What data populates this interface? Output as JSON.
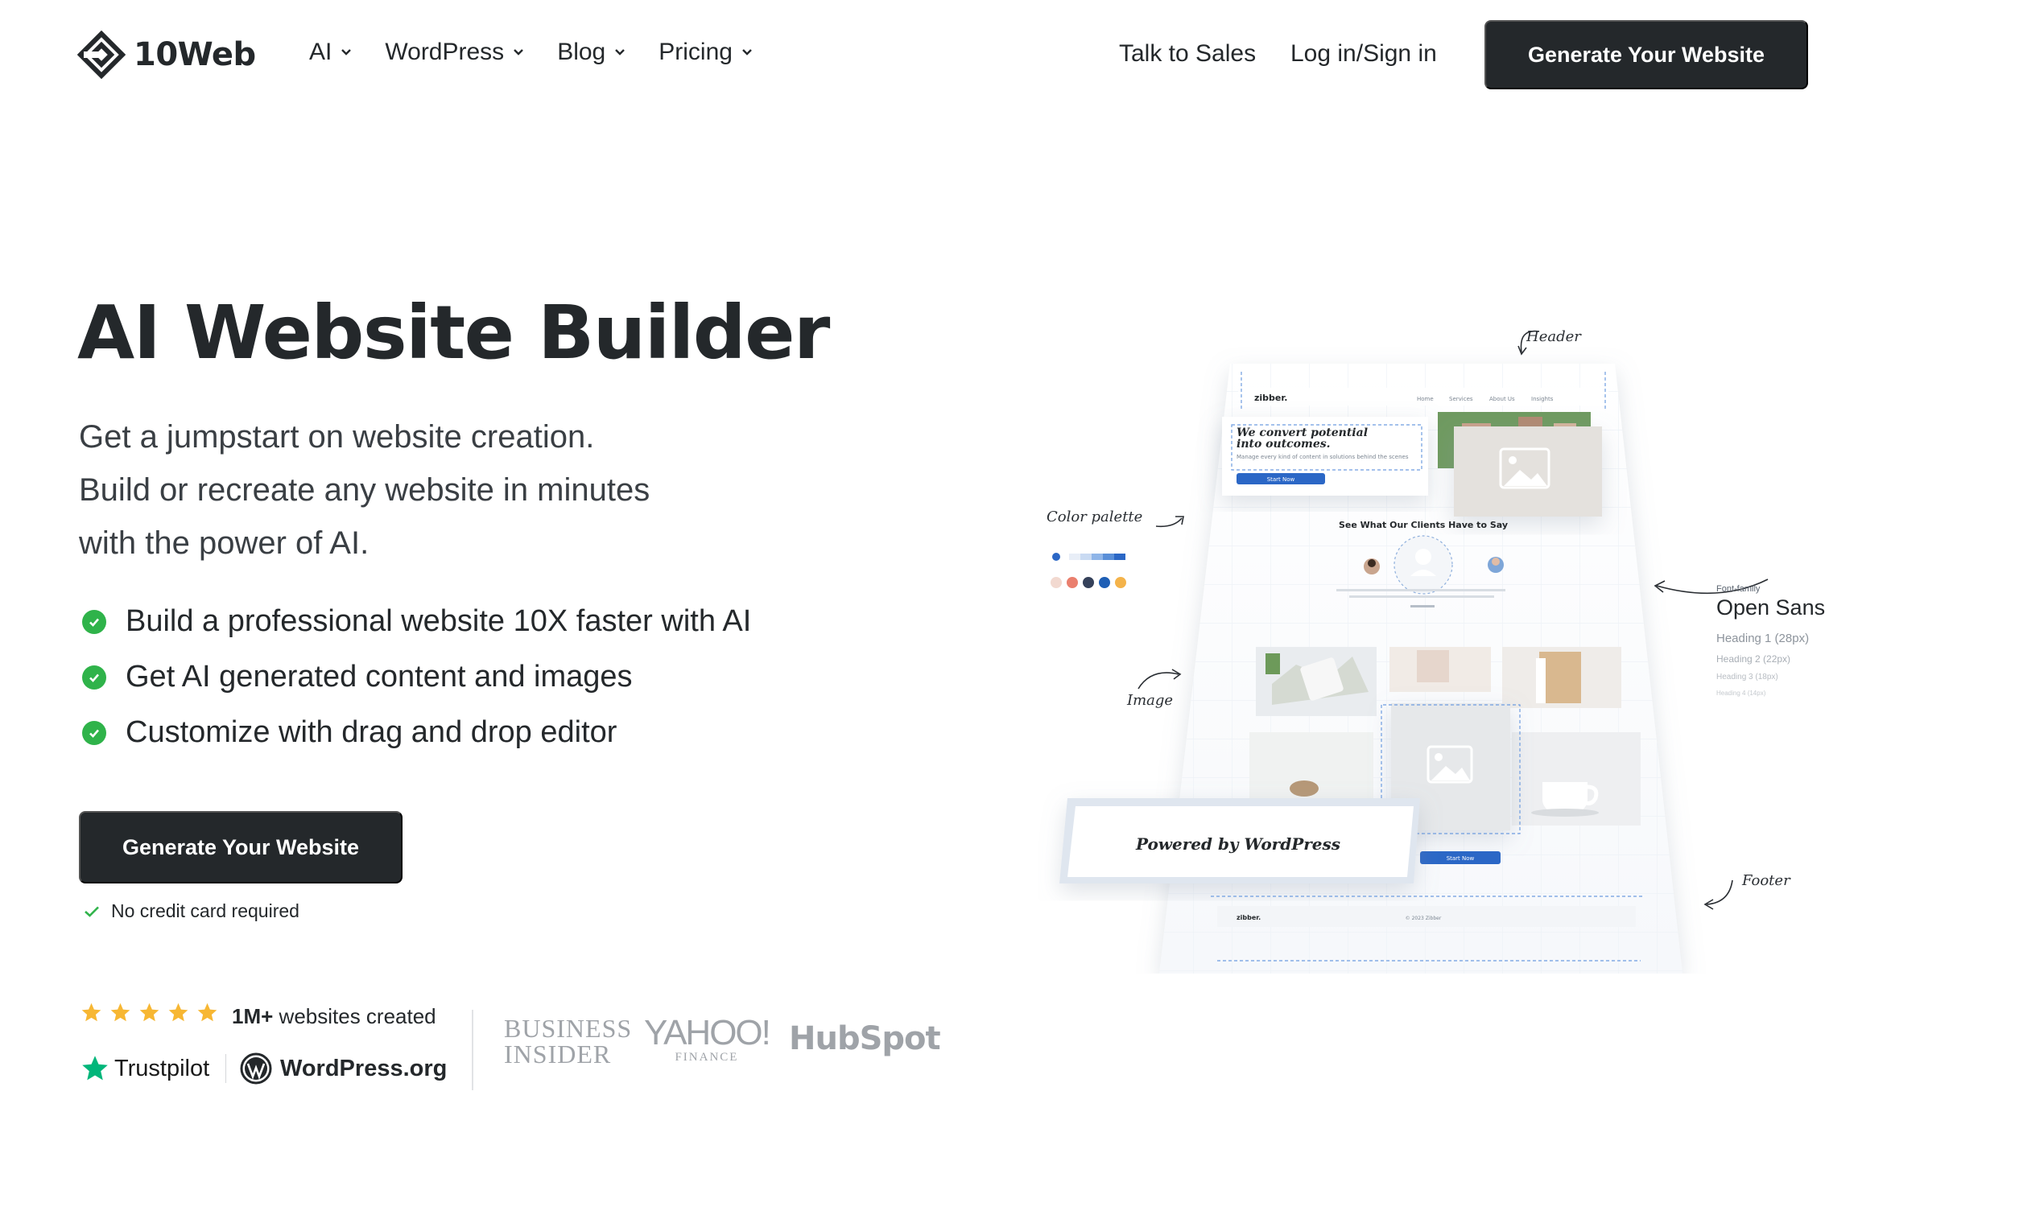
{
  "nav": {
    "logo_text": "10Web",
    "menu": [
      {
        "label": "AI"
      },
      {
        "label": "WordPress"
      },
      {
        "label": "Blog"
      },
      {
        "label": "Pricing"
      }
    ],
    "talk_to_sales": "Talk to Sales",
    "login": "Log in/Sign in",
    "cta": "Generate Your Website"
  },
  "hero": {
    "title": "AI Website Builder",
    "subtitle_lines": [
      "Get a jumpstart on website creation.",
      "Build or recreate any website in minutes",
      "with the power of AI."
    ],
    "features": [
      "Build a professional website 10X faster with AI",
      "Get AI generated content and images",
      "Customize with drag and drop editor"
    ],
    "cta": "Generate Your Website",
    "no_credit_card": "No credit card required"
  },
  "social_proof": {
    "rating_stars": 5,
    "count_bold": "1M+",
    "count_rest": " websites created",
    "trustpilot": "Trustpilot",
    "wordpress_org": "WordPress.org",
    "press": {
      "business_insider_1": "BUSINESS",
      "business_insider_2": "INSIDER",
      "yahoo_main": "YAHOO!",
      "yahoo_sub": "FINANCE",
      "hubspot": "HubSpot"
    }
  },
  "illustration": {
    "annotations": {
      "header": "Header",
      "color_palette": "Color palette",
      "image": "Image",
      "footer": "Footer",
      "font_family_label": "Font-family",
      "font_family_value": "Open Sans",
      "heading1": "Heading 1 (28px)",
      "heading2": "Heading 2 (22px)",
      "heading3": "Heading 3 (18px)",
      "heading4": "Heading 4 (14px)"
    },
    "mock": {
      "brand": "zibber.",
      "nav": [
        "Home",
        "Services",
        "About Us",
        "Insights"
      ],
      "hero_line1": "We convert potential",
      "hero_line2": "into outcomes.",
      "hero_body": "Manage every kind of content in solutions behind the scenes",
      "hero_btn": "Start Now",
      "testimonials_title": "See What Our Clients Have to Say",
      "powered_by": "Powered by WordPress",
      "start_now": "Start Now",
      "footer_brand": "zibber.",
      "footer_copy": "© 2023 Zibber"
    },
    "palette": [
      "#2b67c6",
      "#e8eef7",
      "#c9daf2",
      "#8fb5e8",
      "#5a8fd8",
      "#2b67c6",
      "#f2d9d0",
      "#ea7f6e",
      "#35415a",
      "#1f5fb5",
      "#f4b34a"
    ]
  },
  "colors": {
    "primary_dark": "#24282b",
    "check_green": "#2fb34a",
    "star_gold": "#f7b733",
    "trustpilot_green": "#00b67a",
    "logo_gray": "#9fa3a8"
  }
}
